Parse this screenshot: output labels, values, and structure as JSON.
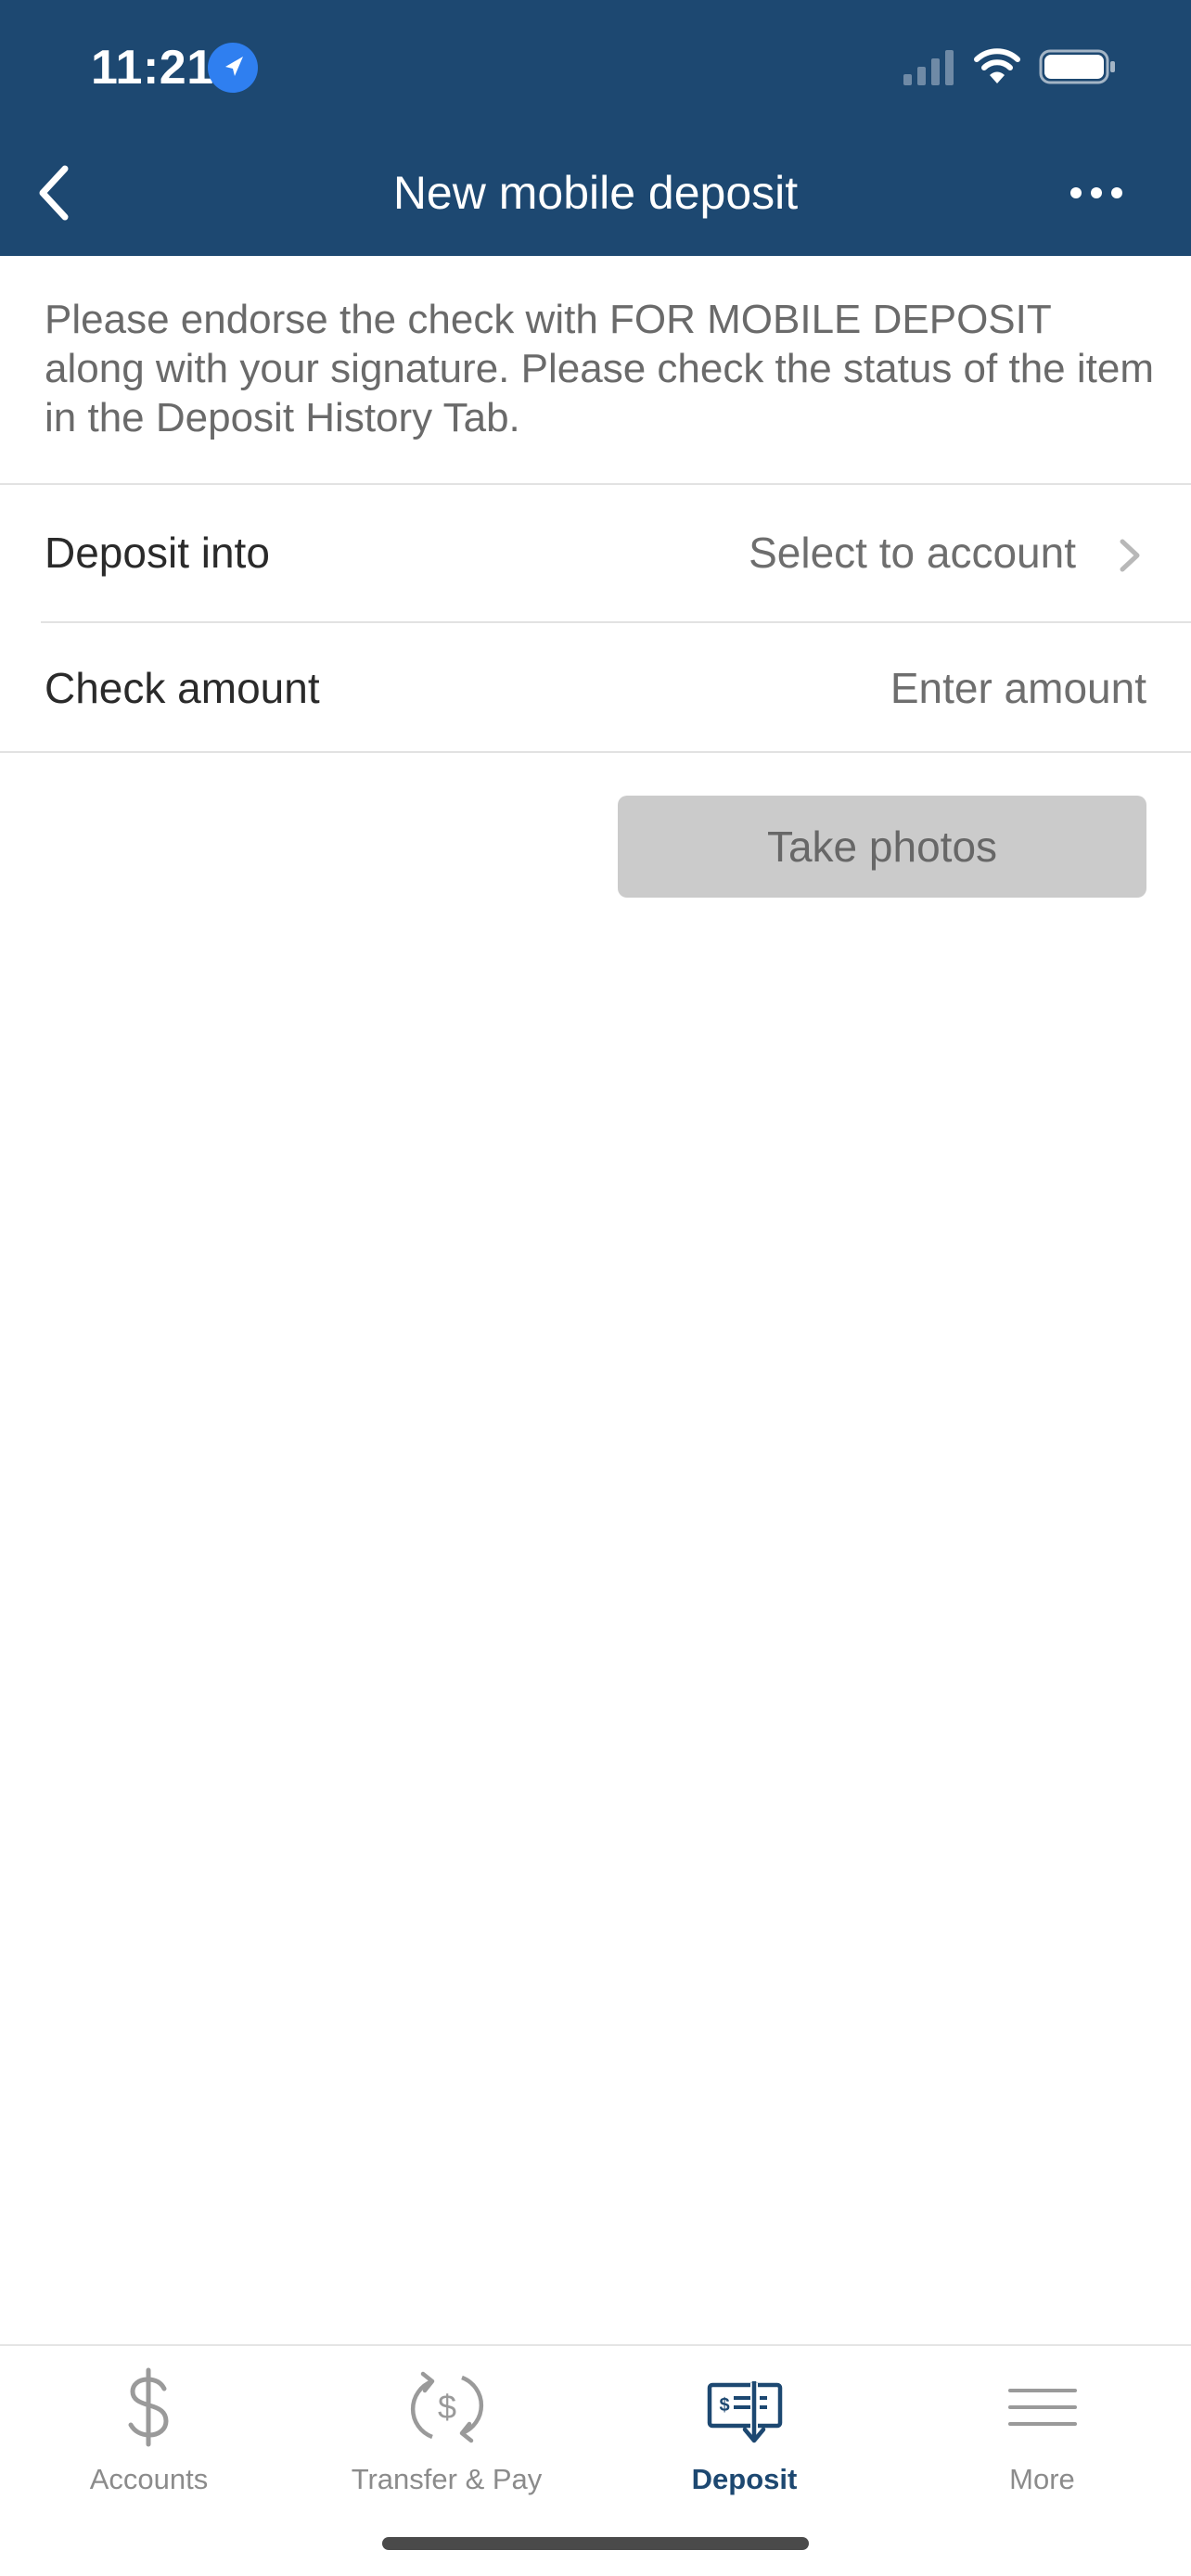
{
  "status_bar": {
    "time": "11:21"
  },
  "nav": {
    "title": "New mobile deposit"
  },
  "intro_text": "Please endorse the check with FOR MOBILE DEPOSIT along with your signature. Please check the status of the item in the Deposit History Tab.",
  "form": {
    "deposit_into": {
      "label": "Deposit into",
      "value": "Select to account"
    },
    "check_amount": {
      "label": "Check amount",
      "value": "",
      "placeholder": "Enter amount"
    }
  },
  "take_photos_label": "Take photos",
  "tabs": [
    {
      "label": "Accounts",
      "icon": "dollar-icon",
      "active": false
    },
    {
      "label": "Transfer & Pay",
      "icon": "transfer-pay-icon",
      "active": false
    },
    {
      "label": "Deposit",
      "icon": "check-deposit-icon",
      "active": true
    },
    {
      "label": "More",
      "icon": "menu-icon",
      "active": false
    }
  ],
  "colors": {
    "header": "#1d4871",
    "accent_blue": "#2f7ff0",
    "active_tab": "#1d4871",
    "inactive_tab": "#8b8b8b",
    "button_disabled_bg": "#cbcbcb"
  }
}
